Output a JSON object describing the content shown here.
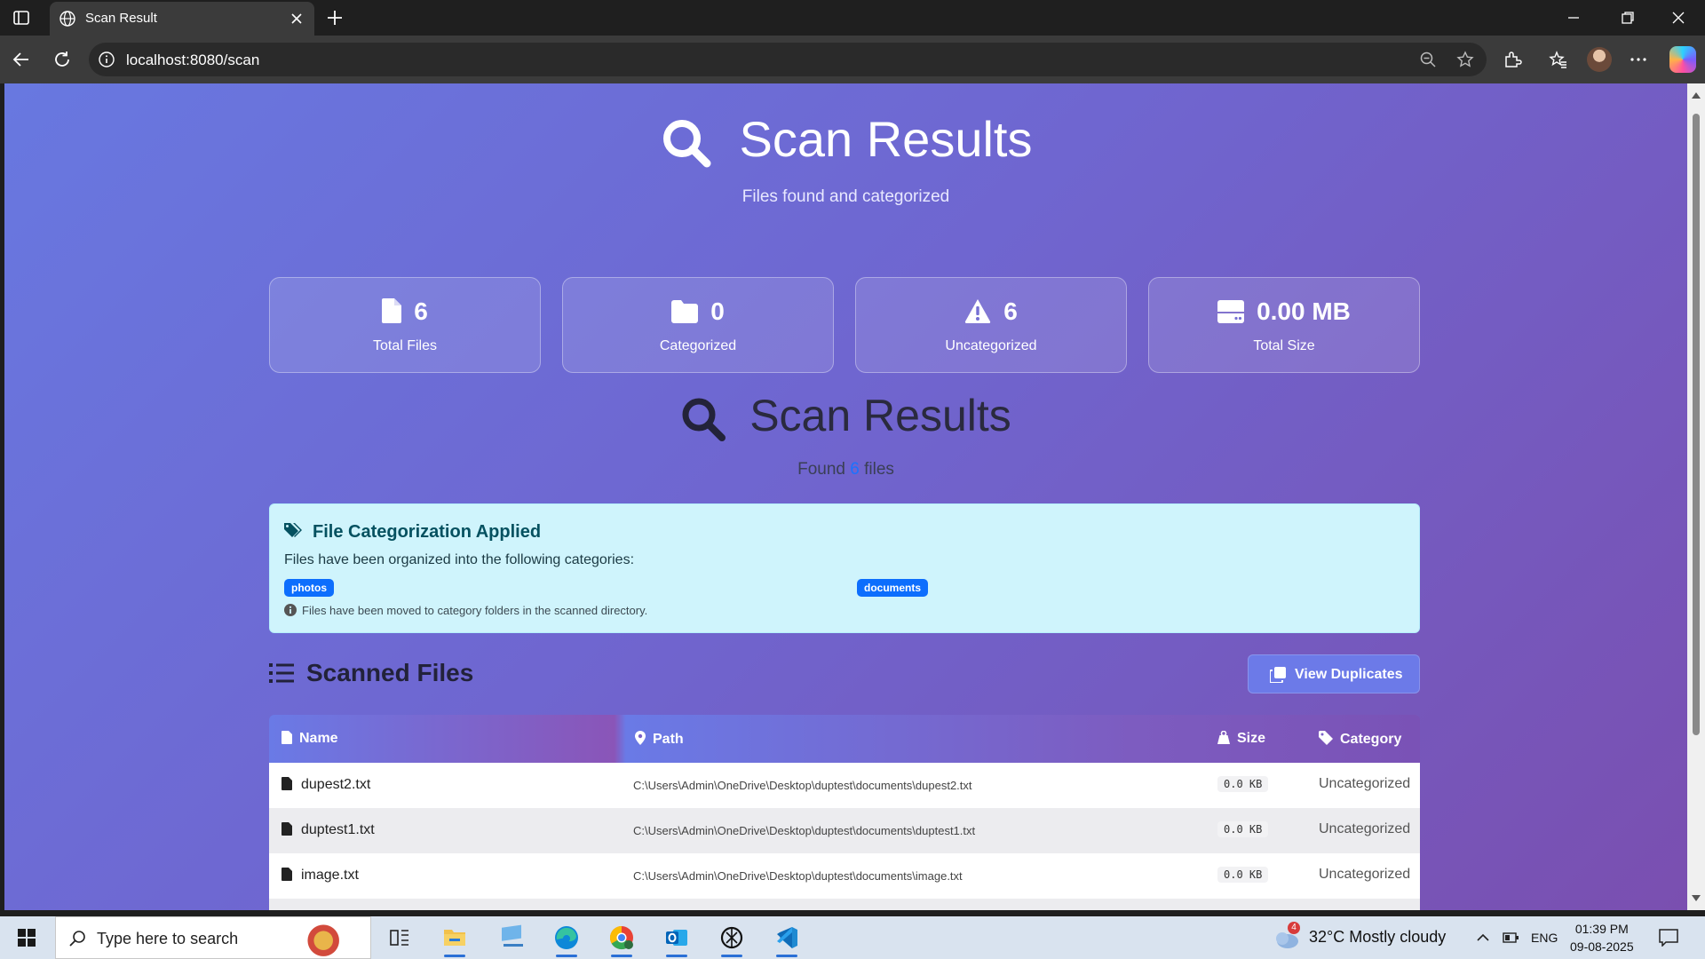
{
  "browser": {
    "tab_title": "Scan Result",
    "url": "localhost:8080/scan"
  },
  "hero": {
    "title": "Scan Results",
    "subtitle": "Files found and categorized"
  },
  "stats": [
    {
      "value": "6",
      "label": "Total Files",
      "icon": "file-icon"
    },
    {
      "value": "0",
      "label": "Categorized",
      "icon": "folder-icon"
    },
    {
      "value": "6",
      "label": "Uncategorized",
      "icon": "warning-icon"
    },
    {
      "value": "0.00 MB",
      "label": "Total Size",
      "icon": "hard-drive-icon"
    }
  ],
  "results": {
    "title": "Scan Results",
    "found_prefix": "Found",
    "found_count": "6",
    "found_suffix": "files"
  },
  "alert": {
    "heading": "File Categorization Applied",
    "text": "Files have been organized into the following categories:",
    "categories": [
      "photos",
      "documents"
    ],
    "note": "Files have been moved to category folders in the scanned directory."
  },
  "files_section": {
    "title": "Scanned Files",
    "duplicates_button": "View Duplicates"
  },
  "table": {
    "headers": [
      "Name",
      "Path",
      "Size",
      "Category"
    ],
    "rows": [
      {
        "name": "dupest2.txt",
        "path": "C:\\Users\\Admin\\OneDrive\\Desktop\\duptest\\documents\\dupest2.txt",
        "size": "0.0 KB",
        "category": "Uncategorized"
      },
      {
        "name": "duptest1.txt",
        "path": "C:\\Users\\Admin\\OneDrive\\Desktop\\duptest\\documents\\duptest1.txt",
        "size": "0.0 KB",
        "category": "Uncategorized"
      },
      {
        "name": "image.txt",
        "path": "C:\\Users\\Admin\\OneDrive\\Desktop\\duptest\\documents\\image.txt",
        "size": "0.0 KB",
        "category": "Uncategorized"
      }
    ]
  },
  "taskbar": {
    "search_placeholder": "Type here to search",
    "weather_badge": "4",
    "weather": "32°C  Mostly cloudy",
    "language": "ENG",
    "time": "01:39 PM",
    "date": "09-08-2025"
  }
}
